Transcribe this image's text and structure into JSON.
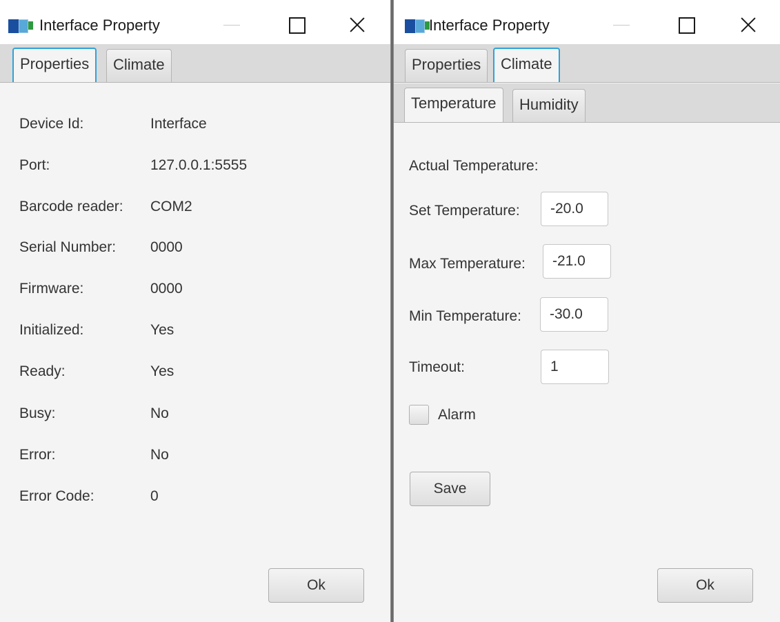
{
  "left_window": {
    "title": "Interface Property",
    "tabs": [
      {
        "label": "Properties",
        "selected": true
      },
      {
        "label": "Climate",
        "selected": false
      }
    ],
    "properties": [
      {
        "label": "Device Id:",
        "value": "Interface"
      },
      {
        "label": "Port:",
        "value": "127.0.0.1:5555"
      },
      {
        "label": "Barcode reader:",
        "value": "COM2"
      },
      {
        "label": "Serial Number:",
        "value": "0000"
      },
      {
        "label": "Firmware:",
        "value": "0000"
      },
      {
        "label": "Initialized:",
        "value": "Yes"
      },
      {
        "label": "Ready:",
        "value": "Yes"
      },
      {
        "label": "Busy:",
        "value": "No"
      },
      {
        "label": "Error:",
        "value": "No"
      },
      {
        "label": "Error Code:",
        "value": "0"
      }
    ],
    "ok_label": "Ok"
  },
  "right_window": {
    "title": "Interface Property",
    "tabs": [
      {
        "label": "Properties",
        "selected": false
      },
      {
        "label": "Climate",
        "selected": true
      }
    ],
    "subtabs": [
      {
        "label": "Temperature",
        "selected": true
      },
      {
        "label": "Humidity",
        "selected": false
      }
    ],
    "actual_temperature_label": "Actual Temperature:",
    "fields": [
      {
        "label": "Set Temperature:",
        "value": "-20.0"
      },
      {
        "label": "Max Temperature:",
        "value": "-21.0"
      },
      {
        "label": "Min Temperature:",
        "value": "-30.0"
      },
      {
        "label": "Timeout:",
        "value": "1"
      }
    ],
    "alarm_label": "Alarm",
    "alarm_checked": false,
    "save_label": "Save",
    "ok_label": "Ok"
  },
  "colors": {
    "accent": "#2fa2d9",
    "background": "#f4f4f4",
    "tab_strip": "#dadada"
  },
  "icons": [
    "app-icon",
    "minimize-icon",
    "maximize-icon",
    "close-icon"
  ]
}
